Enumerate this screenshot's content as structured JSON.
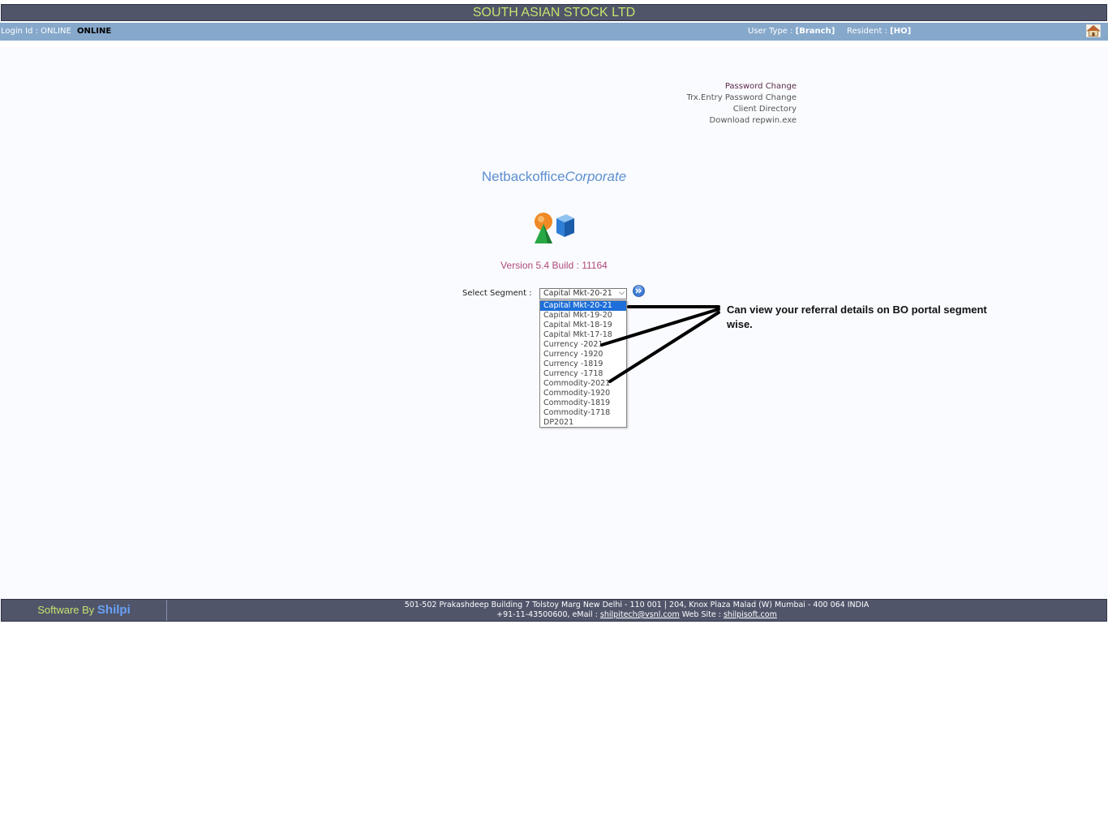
{
  "header": {
    "title": "SOUTH ASIAN STOCK LTD"
  },
  "infobar": {
    "login_label": "Login Id : ONLINE",
    "login_value": "ONLINE",
    "usertype_label": "User Type : ",
    "usertype_value": "[Branch]",
    "resident_label": "Resident : ",
    "resident_value": "[HO]"
  },
  "links": [
    "Password Change",
    "Trx.Entry Password Change",
    "Client Directory",
    "Download repwin.exe"
  ],
  "product": {
    "name": "Netbackoffice",
    "edition": "Corporate"
  },
  "version": "Version 5.4 Build : 11164",
  "segment": {
    "label": "Select Segment :",
    "selected": "Capital Mkt-20-21",
    "options": [
      "Capital Mkt-20-21",
      "Capital Mkt-19-20",
      "Capital Mkt-18-19",
      "Capital Mkt-17-18",
      "Currency -2021",
      "Currency -1920",
      "Currency -1819",
      "Currency -1718",
      "Commodity-2021",
      "Commodity-1920",
      "Commodity-1819",
      "Commodity-1718",
      "DP2021"
    ]
  },
  "annotation": {
    "text": "Can view your referral details on BO portal segment wise."
  },
  "footer": {
    "software_by": "Software By ",
    "brand": "Shilpi",
    "address_line": "501-502 Prakashdeep Building 7 Tolstoy Marg New Delhi - 110 001  |   204, Knox Plaza Malad (W) Mumbai - 400 064 INDIA",
    "phone_email_prefix": "+91-11-43500600, eMail : ",
    "email": "shilpitech@vsnl.com",
    "website_prefix": " Web Site : ",
    "website": "shilpisoft.com"
  },
  "colors": {
    "topbar_bg": "#50556a",
    "title_text": "#c6e46e",
    "infobar_bg": "#86a8cb",
    "selected_option": "#1e6fd9",
    "product_text": "#5c8fd1",
    "version_text": "#b04a7c"
  }
}
